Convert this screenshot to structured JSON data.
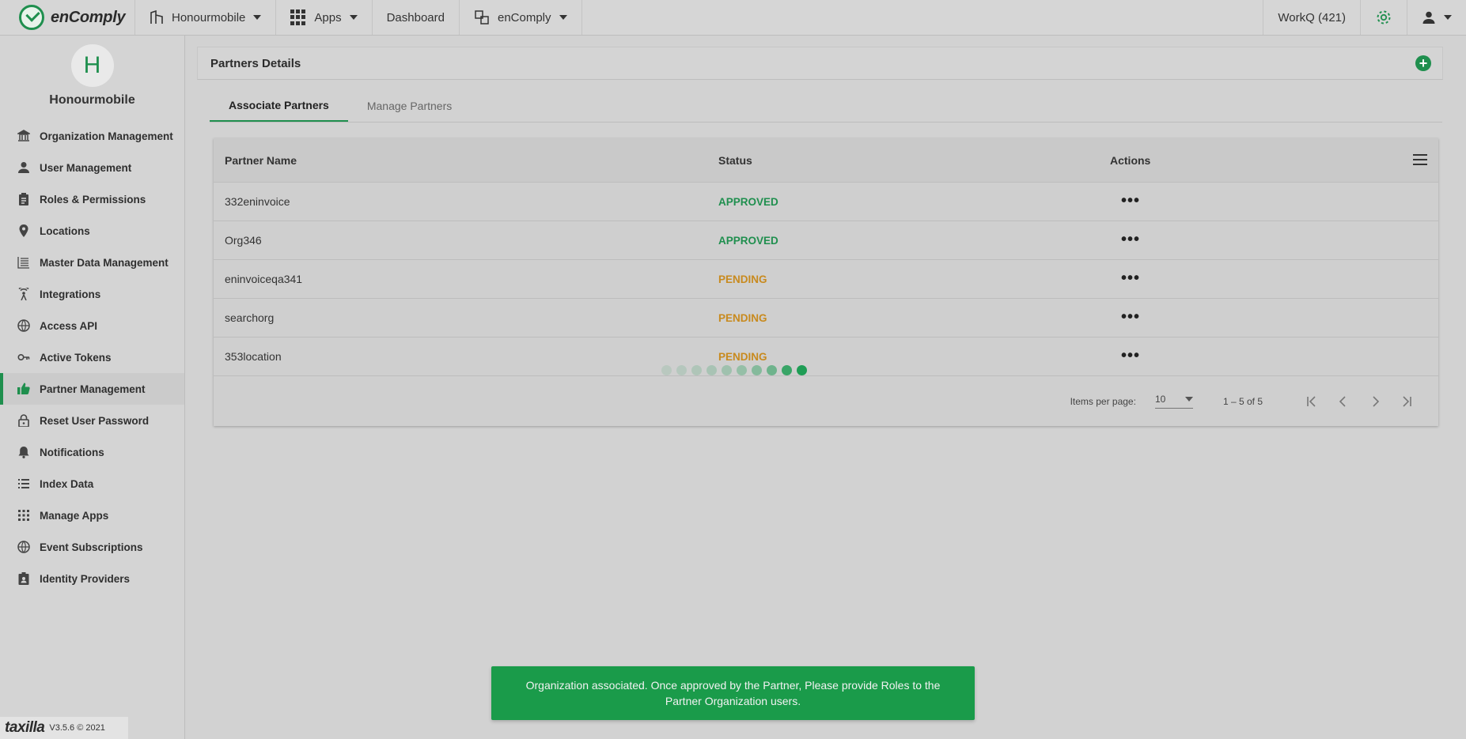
{
  "topbar": {
    "brand": "enComply",
    "org_menu": "Honourmobile",
    "apps_menu": "Apps",
    "dashboard": "Dashboard",
    "app_switcher": "enComply",
    "workq": "WorkQ (421)"
  },
  "sidebar": {
    "avatar_letter": "H",
    "org_name": "Honourmobile",
    "items": [
      {
        "label": "Organization Management",
        "icon": "bank-icon"
      },
      {
        "label": "User Management",
        "icon": "person-icon"
      },
      {
        "label": "Roles & Permissions",
        "icon": "clipboard-icon"
      },
      {
        "label": "Locations",
        "icon": "pin-icon"
      },
      {
        "label": "Master Data Management",
        "icon": "list-icon"
      },
      {
        "label": "Integrations",
        "icon": "antenna-icon"
      },
      {
        "label": "Access API",
        "icon": "globe-icon"
      },
      {
        "label": "Active Tokens",
        "icon": "key-icon"
      },
      {
        "label": "Partner Management",
        "icon": "thumbs-up-icon"
      },
      {
        "label": "Reset User Password",
        "icon": "lock-icon"
      },
      {
        "label": "Notifications",
        "icon": "bell-icon"
      },
      {
        "label": "Index Data",
        "icon": "table-list-icon"
      },
      {
        "label": "Manage Apps",
        "icon": "grid-icon"
      },
      {
        "label": "Event Subscriptions",
        "icon": "globe-icon"
      },
      {
        "label": "Identity Providers",
        "icon": "badge-icon"
      }
    ],
    "active_item": "Partner Management",
    "version_logo": "taxilla",
    "version_text": "V3.5.6 © 2021"
  },
  "main": {
    "title": "Partners Details",
    "add_button": "+",
    "tabs": [
      "Associate Partners",
      "Manage Partners"
    ],
    "active_tab": "Associate Partners",
    "table": {
      "headers": [
        "Partner Name",
        "Status",
        "Actions"
      ],
      "rows": [
        {
          "name": "332eninvoice",
          "status": "APPROVED"
        },
        {
          "name": "Org346",
          "status": "APPROVED"
        },
        {
          "name": "eninvoiceqa341",
          "status": "PENDING"
        },
        {
          "name": "searchorg",
          "status": "PENDING"
        },
        {
          "name": "353location",
          "status": "PENDING"
        }
      ],
      "actions_glyph": "•••"
    },
    "paginator": {
      "label": "Items per page:",
      "per_page": "10",
      "range": "1 – 5 of 5"
    }
  },
  "toast": {
    "message": "Organization associated. Once approved by the Partner, Please provide Roles to the Partner Organization users."
  },
  "colors": {
    "accent": "#1f8f4e",
    "approved": "#1f8f4e",
    "pending": "#c88a1e",
    "toast_bg": "#1a9b4a"
  }
}
